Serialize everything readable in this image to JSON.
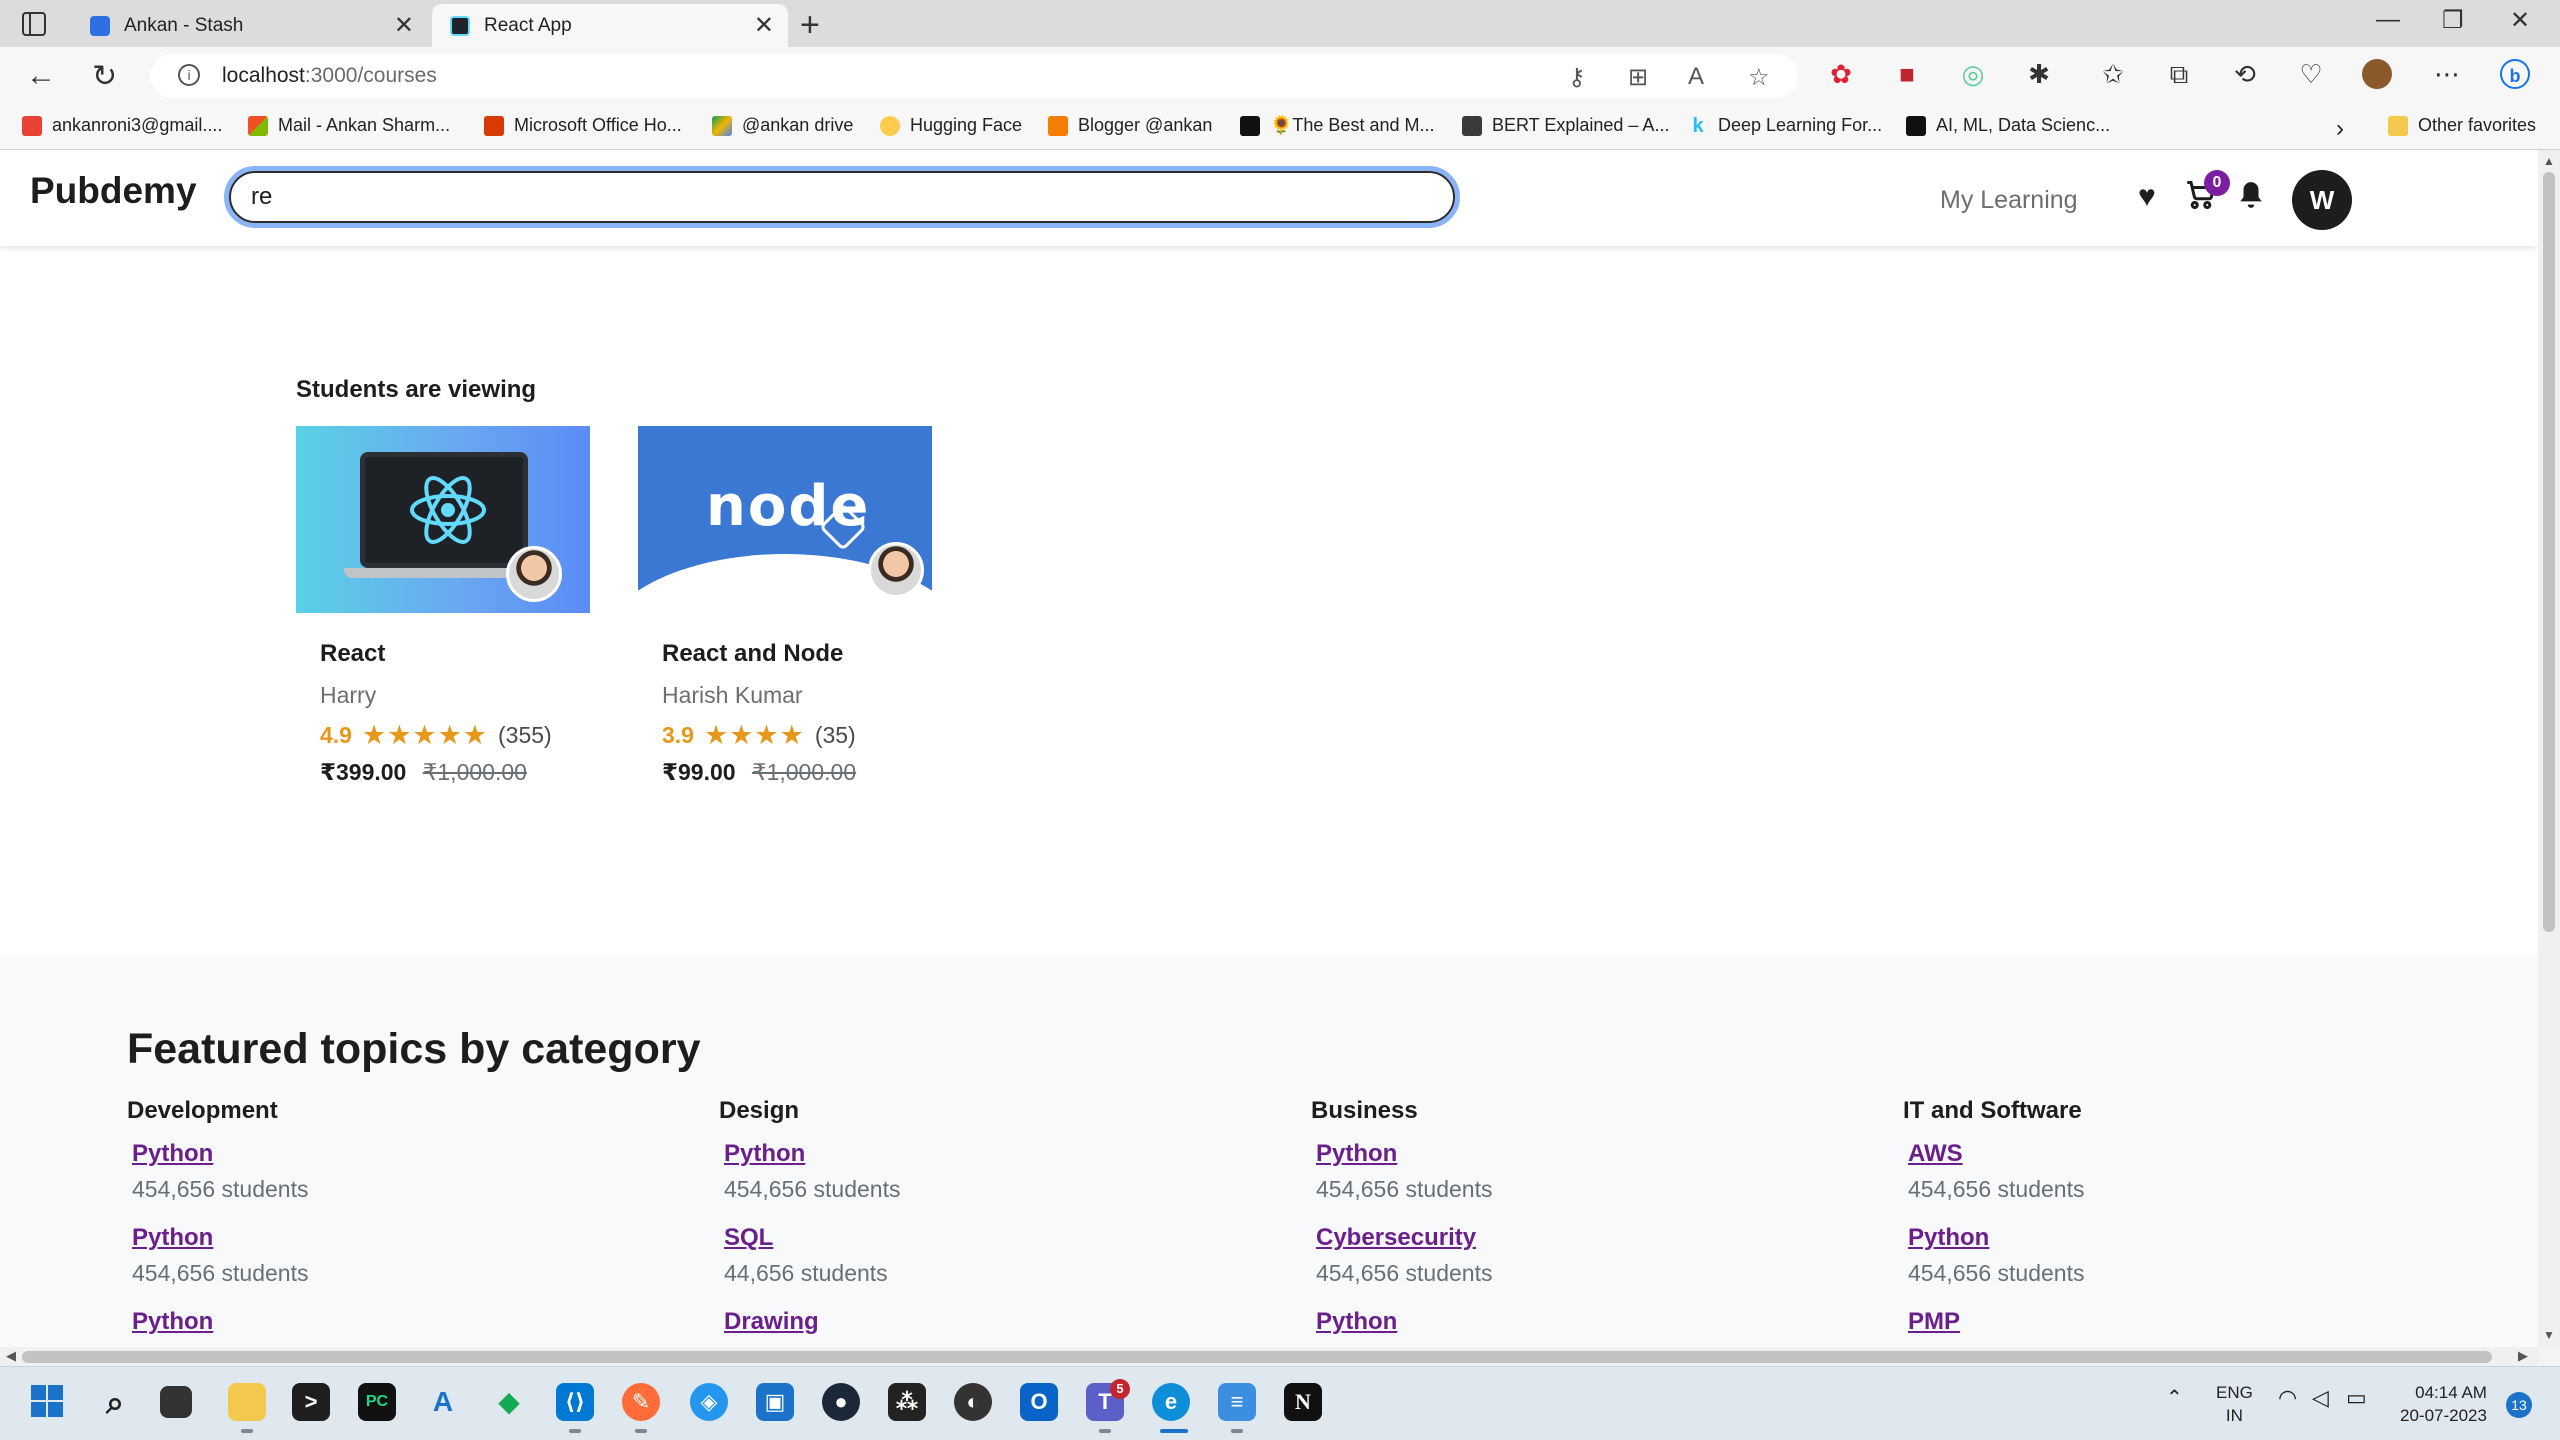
{
  "browser": {
    "tabs": [
      {
        "title": "Ankan - Stash",
        "active": false
      },
      {
        "title": "React App",
        "active": true
      }
    ],
    "url_host": "localhost",
    "url_path": ":3000/courses",
    "bookmarks": [
      "ankanroni3@gmail....",
      "Mail - Ankan Sharm...",
      "Microsoft Office Ho...",
      "@ankan drive",
      "Hugging Face",
      "Blogger @ankan",
      "🌻The Best and M...",
      "BERT Explained – A...",
      "Deep Learning For...",
      "AI, ML, Data Scienc...",
      "Other favorites"
    ]
  },
  "header": {
    "logo": "Pubdemy",
    "search_value": "re",
    "my_learning": "My Learning",
    "cart_count": "0",
    "avatar_initial": "W"
  },
  "viewing": {
    "title": "Students are viewing",
    "courses": [
      {
        "name": "React",
        "instructor": "Harry",
        "rating": "4.9",
        "stars": "★★★★★",
        "reviews": "(355)",
        "price": "₹399.00",
        "original_price": "₹1,000.00"
      },
      {
        "name": "React and Node",
        "instructor": "Harish Kumar",
        "rating": "3.9",
        "stars": "★★★★",
        "reviews": "(35)",
        "price": "₹99.00",
        "original_price": "₹1,000.00"
      }
    ]
  },
  "featured": {
    "title": "Featured topics by category",
    "categories": [
      {
        "name": "Development",
        "topics": [
          {
            "name": "Python",
            "students": "454,656 students"
          },
          {
            "name": "Python",
            "students": "454,656 students"
          },
          {
            "name": "Python",
            "students": ""
          }
        ]
      },
      {
        "name": "Design",
        "topics": [
          {
            "name": "Python",
            "students": "454,656 students"
          },
          {
            "name": "SQL",
            "students": "44,656 students"
          },
          {
            "name": "Drawing",
            "students": ""
          }
        ]
      },
      {
        "name": "Business",
        "topics": [
          {
            "name": "Python",
            "students": "454,656 students"
          },
          {
            "name": "Cybersecurity",
            "students": "454,656 students"
          },
          {
            "name": "Python",
            "students": ""
          }
        ]
      },
      {
        "name": "IT and Software",
        "topics": [
          {
            "name": "AWS",
            "students": "454,656 students"
          },
          {
            "name": "Python",
            "students": "454,656 students"
          },
          {
            "name": "PMP",
            "students": ""
          }
        ]
      }
    ]
  },
  "taskbar": {
    "language": "ENG",
    "region": "IN",
    "time": "04:14 AM",
    "date": "20-07-2023",
    "notifications": "13",
    "teams_badge": "5"
  },
  "colors": {
    "accent_purple": "#7b1fa2",
    "star_orange": "#e59819",
    "link_purple": "#6b1f8c",
    "search_focus": "#8ab4f8"
  }
}
